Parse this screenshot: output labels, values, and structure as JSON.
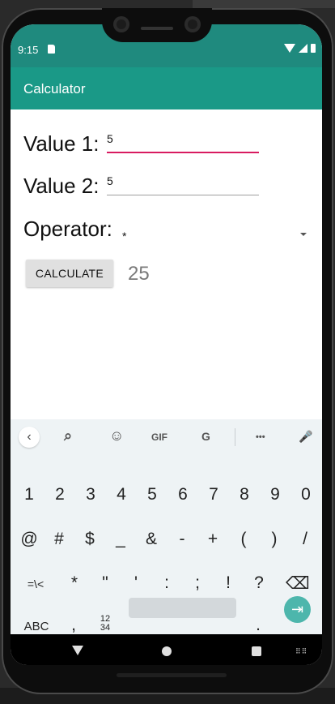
{
  "status_bar": {
    "time": "9:15",
    "icons": [
      "sim-card-icon",
      "wifi-icon",
      "signal-icon",
      "battery-icon"
    ]
  },
  "app_bar": {
    "title": "Calculator"
  },
  "form": {
    "value1_label": "Value 1:",
    "value1_input": "5",
    "value2_label": "Value 2:",
    "value2_input": "5",
    "operator_label": "Operator:",
    "operator_selected": "*",
    "calculate_label": "CALCULATE",
    "result": "25"
  },
  "keyboard": {
    "suggestions": {
      "back": "‹",
      "search": "⌕",
      "sticker": "☺",
      "gif": "GIF",
      "translate": "G",
      "more": "•••",
      "mic": "🎤"
    },
    "row1": [
      "1",
      "2",
      "3",
      "4",
      "5",
      "6",
      "7",
      "8",
      "9",
      "0"
    ],
    "row2": [
      "@",
      "#",
      "$",
      "_",
      "&",
      "-",
      "+",
      "(",
      ")",
      "/"
    ],
    "row3": [
      "=\\<",
      "*",
      "\"",
      "'",
      ":",
      ";",
      "!",
      "?",
      "⌫"
    ],
    "row4": {
      "abc": "ABC",
      "comma": ",",
      "numpad": "12\n34",
      "period": ".",
      "enter": "⇥"
    }
  },
  "nav_bar": {
    "icons": [
      "back-icon",
      "home-icon",
      "recents-icon",
      "keyboard-switch-icon"
    ]
  },
  "colors": {
    "status_bar": "#1f8a7e",
    "app_bar": "#1a9987",
    "accent_pink": "#d81b60",
    "enter_key": "#4db6ac",
    "keyboard_bg": "#eef3f5"
  }
}
